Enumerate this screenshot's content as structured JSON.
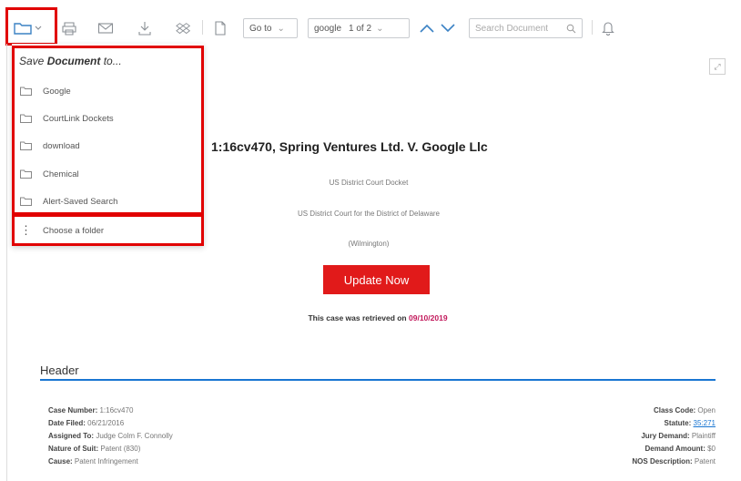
{
  "toolbar": {
    "goto_label": "Go to",
    "search_term": "google",
    "match_counter": "1 of 2",
    "search_placeholder": "Search Document"
  },
  "save_menu": {
    "title_prefix": "Save",
    "title_bold": "Document",
    "title_suffix": "to...",
    "folders": [
      "Google",
      "CourtLink Dockets",
      "download",
      "Chemical",
      "Alert-Saved Search"
    ],
    "choose_folder": "Choose a folder"
  },
  "document": {
    "case_title": "1:16cv470, Spring Ventures Ltd. V. Google Llc",
    "docket_type": "US District Court Docket",
    "court": "US District Court for the District of Delaware",
    "location": "(Wilmington)",
    "update_button": "Update Now",
    "retrieved_prefix": "This case was retrieved on",
    "retrieved_date": "09/10/2019",
    "header_title": "Header",
    "left_fields": [
      {
        "label": "Case Number:",
        "value": "1:16cv470"
      },
      {
        "label": "Date Filed:",
        "value": "06/21/2016"
      },
      {
        "label": "Assigned To:",
        "value": "Judge Colm F. Connolly"
      },
      {
        "label": "Nature of Suit:",
        "value": "Patent (830)"
      },
      {
        "label": "Cause:",
        "value": "Patent Infringement"
      }
    ],
    "right_fields": [
      {
        "label": "Class Code:",
        "value": "Open"
      },
      {
        "label": "Statute:",
        "value": "35:271"
      },
      {
        "label": "Jury Demand:",
        "value": "Plaintiff"
      },
      {
        "label": "Demand Amount:",
        "value": "$0"
      },
      {
        "label": "NOS Description:",
        "value": "Patent"
      }
    ]
  },
  "colors": {
    "highlight_box": "#e10000",
    "update_button": "#e11a1a",
    "accent_blue": "#1976d2",
    "date_color": "#c2185b"
  }
}
